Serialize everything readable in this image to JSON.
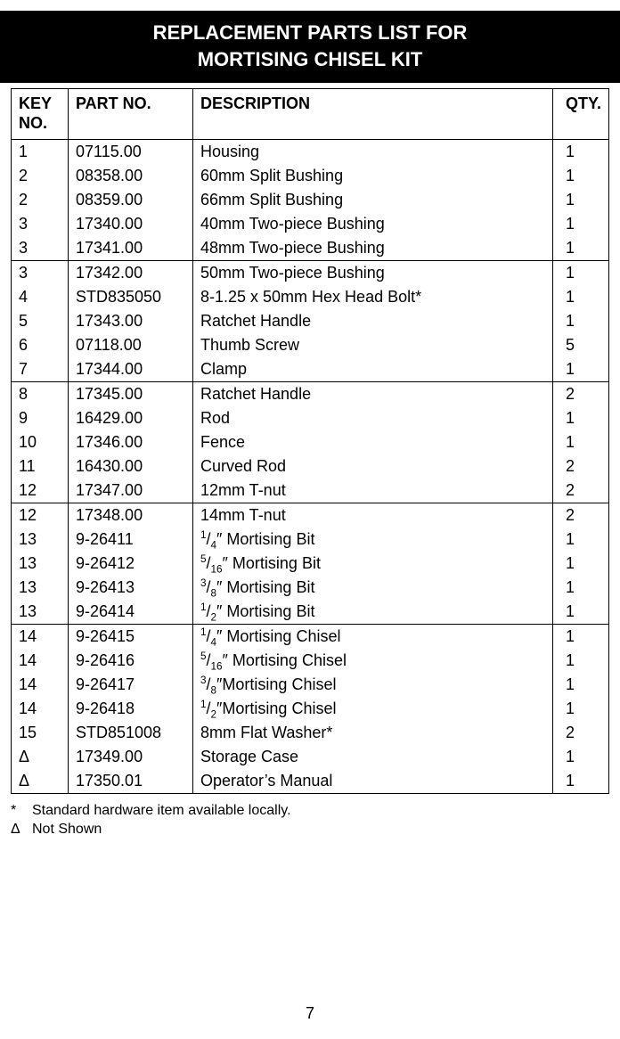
{
  "title_line1": "REPLACEMENT PARTS LIST FOR",
  "title_line2": "MORTISING CHISEL KIT",
  "columns": {
    "key": "KEY\nNO.",
    "part": "PART NO.",
    "desc": "DESCRIPTION",
    "qty": "QTY."
  },
  "rows": [
    {
      "key": "1",
      "part": "07115.00",
      "desc": "Housing",
      "qty": "1",
      "sep": false
    },
    {
      "key": "2",
      "part": "08358.00",
      "desc": "60mm Split Bushing",
      "qty": "1",
      "sep": false
    },
    {
      "key": "2",
      "part": "08359.00",
      "desc": "66mm Split Bushing",
      "qty": "1",
      "sep": false
    },
    {
      "key": "3",
      "part": "17340.00",
      "desc": "40mm Two-piece Bushing",
      "qty": "1",
      "sep": false
    },
    {
      "key": "3",
      "part": "17341.00",
      "desc": "48mm Two-piece Bushing",
      "qty": "1",
      "sep": true
    },
    {
      "key": "3",
      "part": "17342.00",
      "desc": "50mm Two-piece Bushing",
      "qty": "1",
      "sep": false
    },
    {
      "key": "4",
      "part": "STD835050",
      "desc": "8-1.25 x 50mm Hex Head Bolt*",
      "qty": "1",
      "sep": false
    },
    {
      "key": "5",
      "part": "17343.00",
      "desc": "Ratchet Handle",
      "qty": "1",
      "sep": false
    },
    {
      "key": "6",
      "part": "07118.00",
      "desc": "Thumb Screw",
      "qty": "5",
      "sep": false
    },
    {
      "key": "7",
      "part": "17344.00",
      "desc": "Clamp",
      "qty": "1",
      "sep": true
    },
    {
      "key": "8",
      "part": "17345.00",
      "desc": "Ratchet Handle",
      "qty": "2",
      "sep": false
    },
    {
      "key": "9",
      "part": "16429.00",
      "desc": "Rod",
      "qty": "1",
      "sep": false
    },
    {
      "key": "10",
      "part": "17346.00",
      "desc": "Fence",
      "qty": "1",
      "sep": false
    },
    {
      "key": "11",
      "part": "16430.00",
      "desc": "Curved Rod",
      "qty": "2",
      "sep": false
    },
    {
      "key": "12",
      "part": "17347.00",
      "desc": "12mm T-nut",
      "qty": "2",
      "sep": true
    },
    {
      "key": "12",
      "part": "17348.00",
      "desc": "14mm T-nut",
      "qty": "2",
      "sep": false
    },
    {
      "key": "13",
      "part": "9-26411",
      "desc_html": "<span class='frac'><span class='sup'>1</span>/<span class='sub'>4</span></span>″ Mortising Bit",
      "desc": "1/4″ Mortising Bit",
      "qty": "1",
      "sep": false
    },
    {
      "key": "13",
      "part": "9-26412",
      "desc_html": "<span class='frac'><span class='sup'>5</span>/<span class='sub'>16</span></span>″ Mortising Bit",
      "desc": "5/16″ Mortising Bit",
      "qty": "1",
      "sep": false
    },
    {
      "key": "13",
      "part": "9-26413",
      "desc_html": "<span class='frac'><span class='sup'>3</span>/<span class='sub'>8</span></span>″ Mortising Bit",
      "desc": "3/8″ Mortising Bit",
      "qty": "1",
      "sep": false
    },
    {
      "key": "13",
      "part": "9-26414",
      "desc_html": "<span class='frac'><span class='sup'>1</span>/<span class='sub'>2</span></span>″ Mortising Bit",
      "desc": "1/2″ Mortising Bit",
      "qty": "1",
      "sep": true
    },
    {
      "key": "14",
      "part": "9-26415",
      "desc_html": "<span class='frac'><span class='sup'>1</span>/<span class='sub'>4</span></span>″ Mortising Chisel",
      "desc": "1/4″ Mortising Chisel",
      "qty": "1",
      "sep": false
    },
    {
      "key": "14",
      "part": "9-26416",
      "desc_html": "<span class='frac'><span class='sup'>5</span>/<span class='sub'>16</span></span>″ Mortising Chisel",
      "desc": "5/16″ Mortising Chisel",
      "qty": "1",
      "sep": false
    },
    {
      "key": "14",
      "part": "9-26417",
      "desc_html": "<span class='frac'><span class='sup'>3</span>/<span class='sub'>8</span></span>″Mortising Chisel",
      "desc": "3/8″Mortising Chisel",
      "qty": "1",
      "sep": false
    },
    {
      "key": "14",
      "part": "9-26418",
      "desc_html": "<span class='frac'><span class='sup'>1</span>/<span class='sub'>2</span></span>″Mortising Chisel",
      "desc": "1/2″Mortising Chisel",
      "qty": "1",
      "sep": false
    },
    {
      "key": "15",
      "part": "STD851008",
      "desc": "8mm Flat Washer*",
      "qty": "2",
      "sep": false
    },
    {
      "key": "Δ",
      "part": "17349.00",
      "desc": "Storage Case",
      "qty": "1",
      "sep": false
    },
    {
      "key": "Δ",
      "part": "17350.01",
      "desc": "Operator’s Manual",
      "qty": "1",
      "sep": true
    }
  ],
  "footnotes": [
    {
      "sym": "*",
      "text": "Standard hardware item available locally."
    },
    {
      "sym": "Δ",
      "text": "Not Shown"
    }
  ],
  "page_number": "7"
}
